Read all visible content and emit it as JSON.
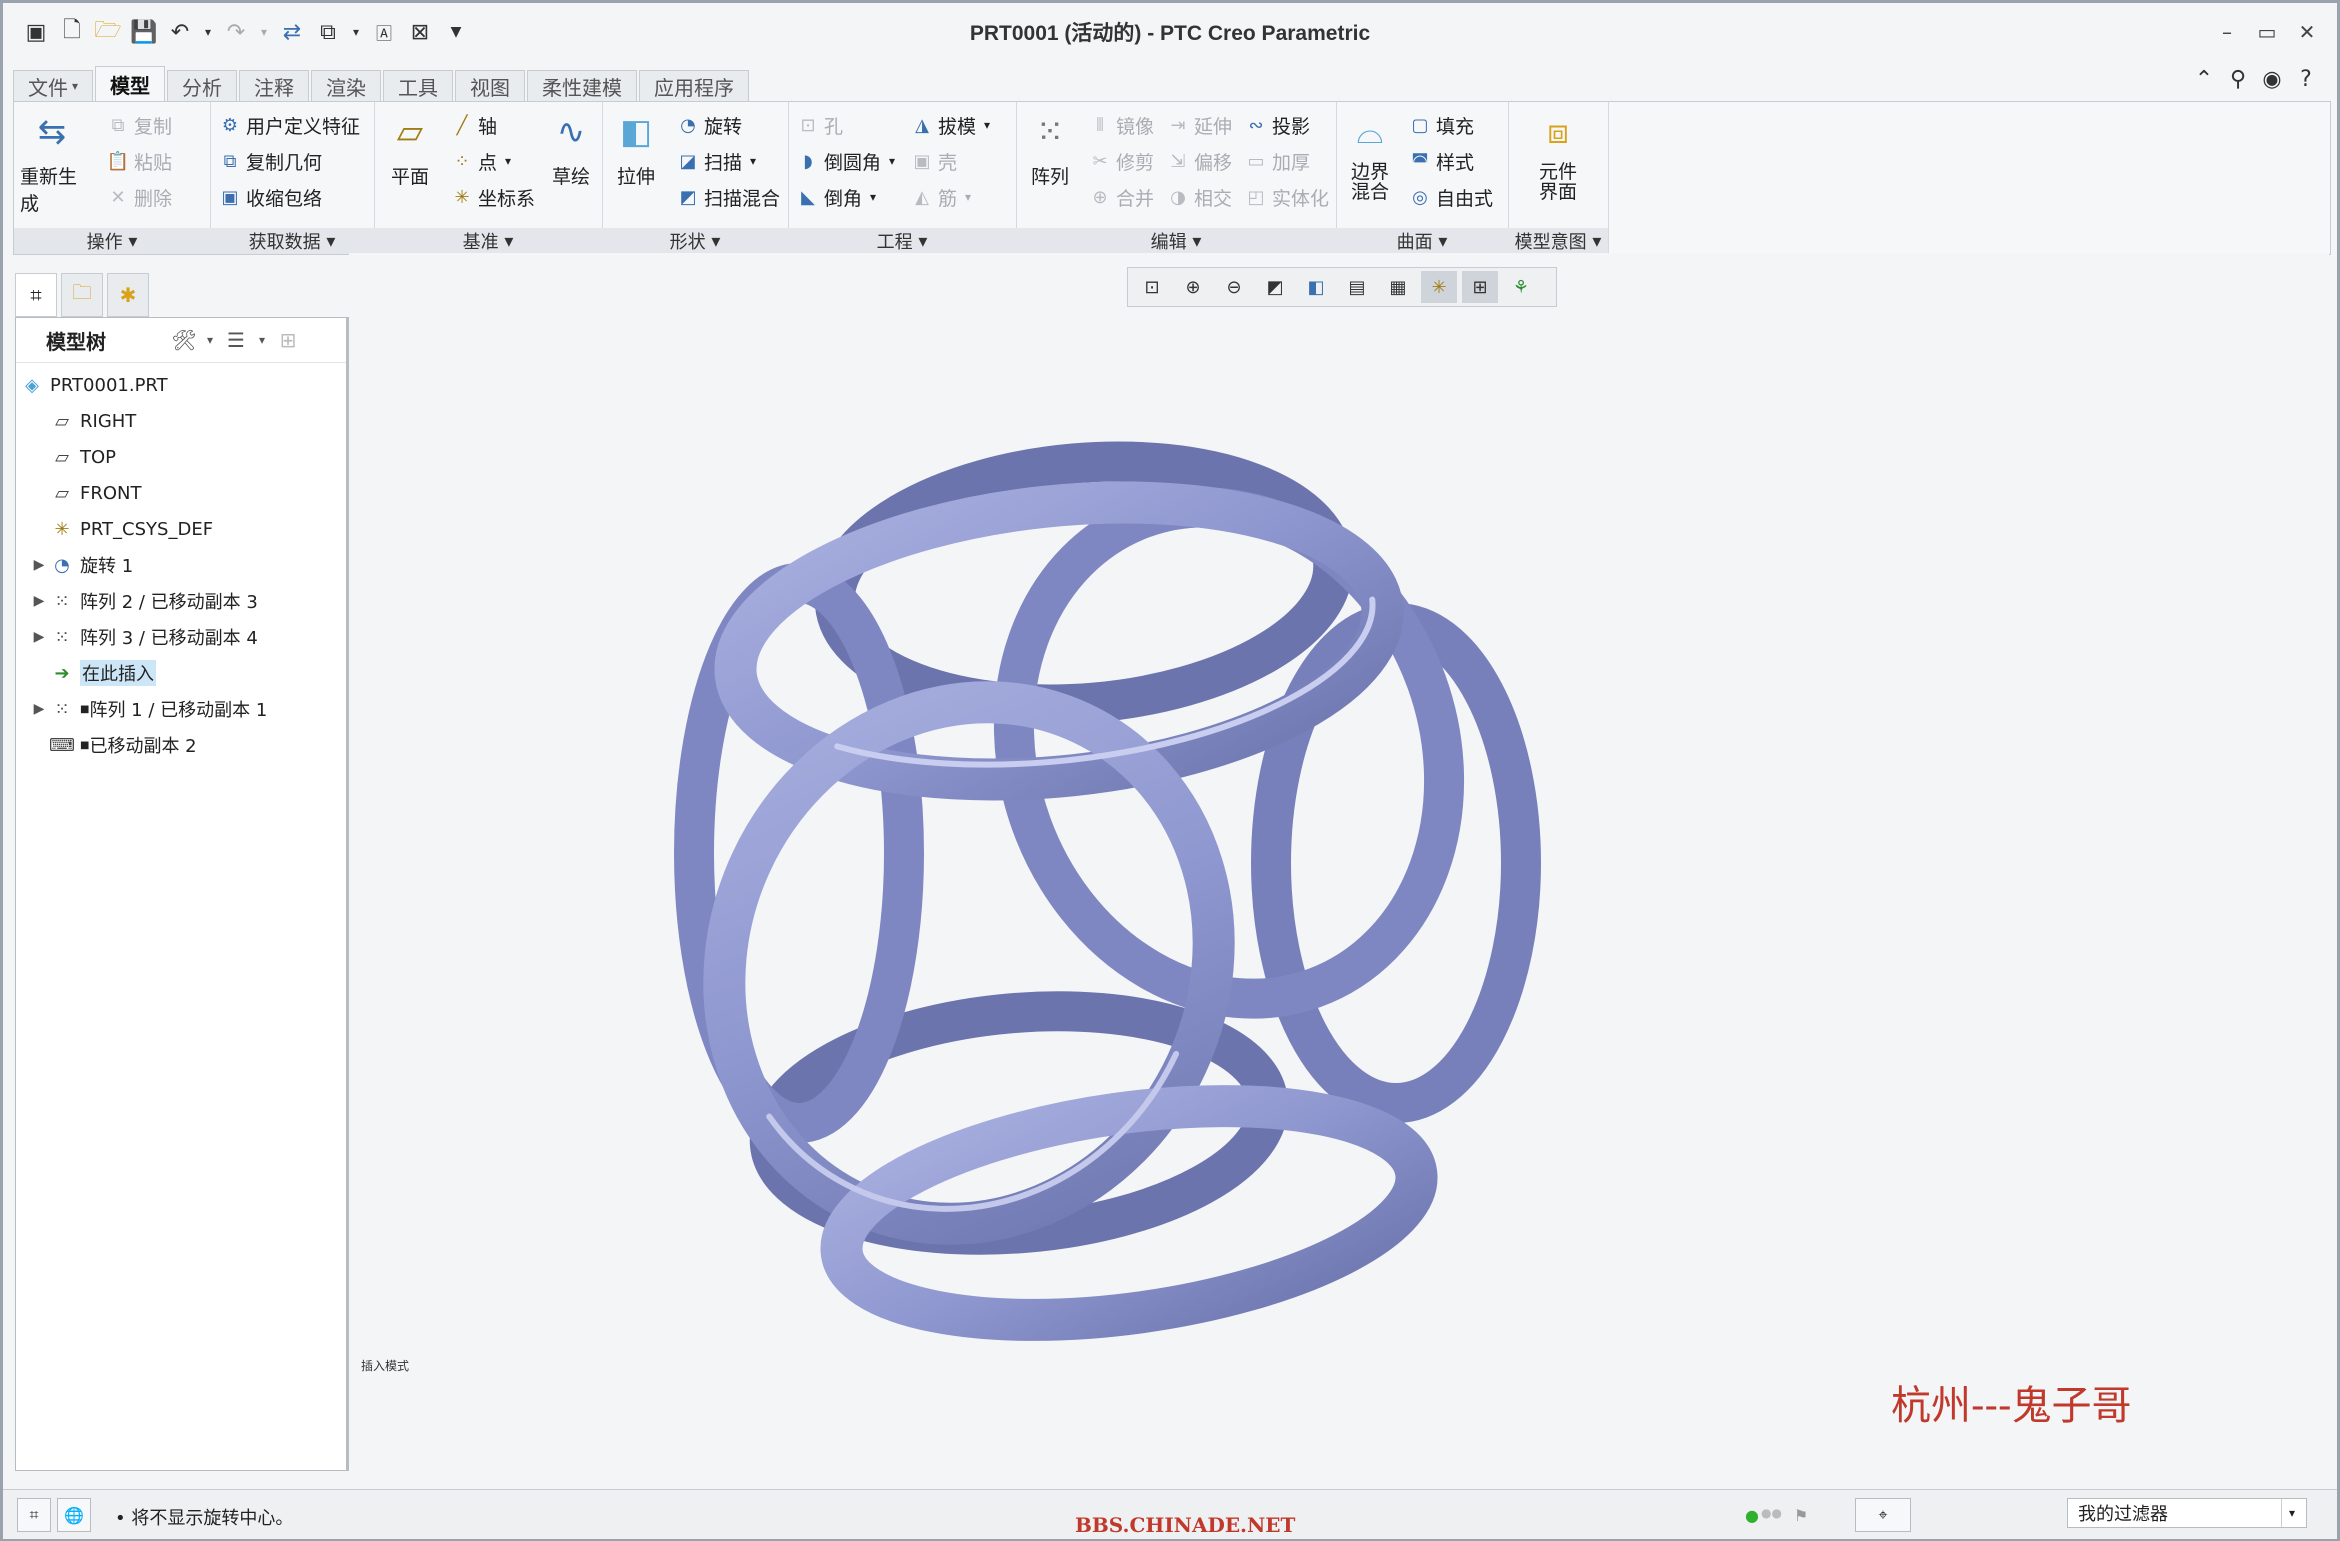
{
  "window": {
    "title": "PRT0001 (活动的) - PTC Creo Parametric"
  },
  "tabs": [
    "文件",
    "模型",
    "分析",
    "注释",
    "渲染",
    "工具",
    "视图",
    "柔性建模",
    "应用程序"
  ],
  "ribbon": {
    "operations": {
      "label": "操作",
      "regen": "重新生成",
      "copy": "复制",
      "paste": "粘贴",
      "delete": "删除"
    },
    "get_data": {
      "label": "获取数据",
      "udf": "用户定义特征",
      "copy_geom": "复制几何",
      "shrinkwrap": "收缩包络"
    },
    "datum": {
      "label": "基准",
      "plane": "平面",
      "axis": "轴",
      "point": "点",
      "csys": "坐标系",
      "sketch": "草绘"
    },
    "shapes": {
      "label": "形状",
      "extrude": "拉伸",
      "revolve": "旋转",
      "sweep": "扫描",
      "swept_blend": "扫描混合"
    },
    "engineering": {
      "label": "工程",
      "hole": "孔",
      "draft": "拔模",
      "round": "倒圆角",
      "shell": "壳",
      "chamfer": "倒角",
      "rib": "筋"
    },
    "editing": {
      "label": "编辑",
      "pattern": "阵列",
      "mirror": "镜像",
      "extend": "延伸",
      "project": "投影",
      "trim": "修剪",
      "offset": "偏移",
      "thicken": "加厚",
      "merge": "合并",
      "intersect": "相交",
      "solidify": "实体化"
    },
    "surfaces": {
      "label": "曲面",
      "boundary_blend": "边界混合",
      "fill": "填充",
      "style": "样式",
      "freestyle": "自由式"
    },
    "model_intent": {
      "label": "模型意图",
      "component_interface": "元件界面"
    }
  },
  "model_tree": {
    "header": "模型树",
    "items": [
      {
        "label": "PRT0001.PRT",
        "icon": "part-icon"
      },
      {
        "label": "RIGHT",
        "icon": "datum-plane-icon"
      },
      {
        "label": "TOP",
        "icon": "datum-plane-icon"
      },
      {
        "label": "FRONT",
        "icon": "datum-plane-icon"
      },
      {
        "label": "PRT_CSYS_DEF",
        "icon": "csys-icon"
      },
      {
        "label": "旋转 1",
        "icon": "revolve-icon"
      },
      {
        "label": "阵列 2 / 已移动副本 3",
        "icon": "pattern-icon"
      },
      {
        "label": "阵列 3 / 已移动副本 4",
        "icon": "pattern-icon"
      },
      {
        "label": "在此插入",
        "icon": "insert-arrow-icon"
      },
      {
        "label": "阵列 1 / 已移动副本 1",
        "icon": "pattern-icon"
      },
      {
        "label": "已移动副本 2",
        "icon": "moved-copy-icon"
      }
    ]
  },
  "viewport": {
    "insert_mode_label": "插入模式",
    "watermark": "杭州---鬼子哥",
    "model_color": "#8e97cf"
  },
  "status": {
    "message": "将不显示旋转中心。",
    "site": "BBS.CHINADE.NET",
    "filter": "我的过滤器"
  }
}
